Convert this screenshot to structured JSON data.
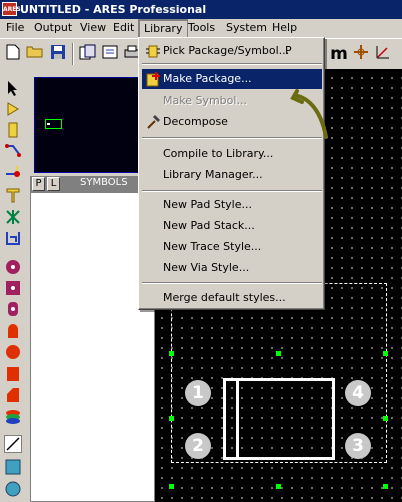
{
  "window": {
    "app_icon_text": "ARES",
    "title": "UNTITLED - ARES Professional"
  },
  "menubar": {
    "items": [
      "File",
      "Output",
      "View",
      "Edit",
      "Library",
      "Tools",
      "System",
      "Help"
    ],
    "active": "Library"
  },
  "toolbar": {
    "right_label": "m"
  },
  "panel": {
    "tab_p": "P",
    "tab_l": "L",
    "title": "SYMBOLS"
  },
  "library_menu": {
    "items": [
      {
        "label": "Pick Package/Symbol...",
        "shortcut": "P",
        "icon": "pick-package-icon",
        "state": "normal"
      },
      {
        "label": "Make Package...",
        "icon": "make-package-icon",
        "state": "highlighted"
      },
      {
        "label": "Make Symbol...",
        "state": "disabled"
      },
      {
        "label": "Decompose",
        "icon": "hammer-icon",
        "state": "normal"
      },
      {
        "label": "Compile to Library...",
        "state": "normal"
      },
      {
        "label": "Library Manager...",
        "state": "normal"
      },
      {
        "label": "New Pad Style...",
        "state": "normal"
      },
      {
        "label": "New Pad Stack...",
        "state": "normal"
      },
      {
        "label": "New Trace Style...",
        "state": "normal"
      },
      {
        "label": "New Via Style...",
        "state": "normal"
      },
      {
        "label": "Merge default styles...",
        "state": "normal"
      }
    ]
  },
  "package": {
    "pads": [
      "1",
      "2",
      "3",
      "4"
    ]
  },
  "colors": {
    "highlight": "#0a246a",
    "selection_handle": "#00ff00",
    "annotation_arrow": "#6b6b12"
  }
}
